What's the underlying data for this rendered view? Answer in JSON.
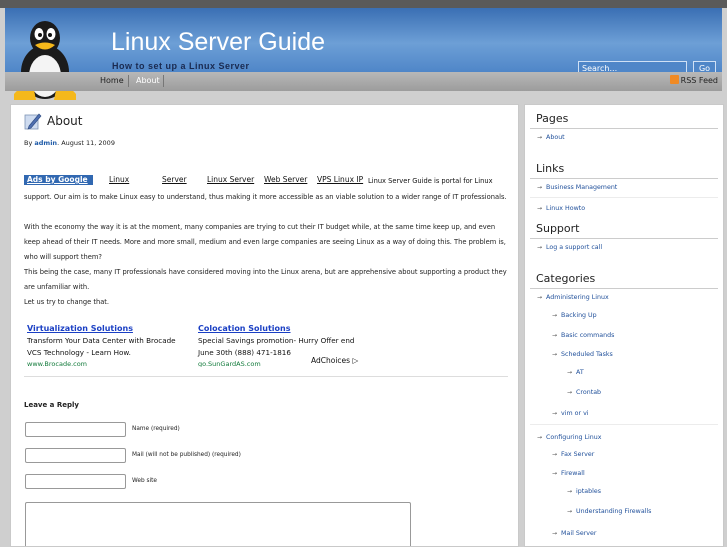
{
  "header": {
    "site_title": "Linux Server Guide",
    "site_description": "How to set up a Linux Server",
    "search_placeholder": "Search...",
    "go_label": "Go"
  },
  "nav": {
    "home": "Home",
    "about": "About",
    "rss": "RSS Feed"
  },
  "post": {
    "title": "About",
    "meta_prefix": "By",
    "author": "admin",
    "date": ". August 11, 2009",
    "ads_label": "Ads by Google",
    "ad_links": [
      "Linux",
      "Server",
      "Linux Server",
      "Web Server",
      "VPS Linux IP"
    ],
    "paragraph_1_line_1": "Linux Server Guide is portal for Linux",
    "paragraph_1_rest": "support. Our aim is to make Linux easy to understand, thus making it more accessible as an viable solution to a wider range of IT professionals.",
    "paragraph_2": "With the economy the way it is at the moment, many companies are trying to cut their IT budget while, at the same time keep up, and even keep ahead of their IT needs. More and more small, medium and even large companies are seeing Linux as a way of doing this. The problem is, who will support them?",
    "paragraph_3": "This being the case, many IT professionals have considered moving into the Linux arena, but are apprehensive about supporting a product they are unfamiliar with.",
    "paragraph_4": "Let us try to change that."
  },
  "ads": [
    {
      "title": "Virtualization Solutions",
      "line1": "Transform Your Data Center with Brocade",
      "line2": "VCS Technology - Learn How.",
      "url": "www.Brocade.com"
    },
    {
      "title": "Colocation Solutions",
      "line1": "Special Savings promotion- Hurry Offer end",
      "line2": "June 30th (888) 471-1816",
      "url": "go.SunGardAS.com"
    }
  ],
  "adchoices": "AdChoices",
  "reply": {
    "title": "Leave a Reply",
    "name_label": "Name (required)",
    "mail_label": "Mail (will not be published) (required)",
    "website_label": "Web site"
  },
  "sidebar": {
    "pages_heading": "Pages",
    "pages": [
      "About"
    ],
    "links_heading": "Links",
    "links": [
      "Business Management",
      "Linux Howto"
    ],
    "support_heading": "Support",
    "support": [
      "Log a support call"
    ],
    "categories_heading": "Categories",
    "categories": [
      "Administering Linux",
      "Backing Up",
      "Basic commands",
      "Scheduled Tasks",
      "AT",
      "Crontab",
      "vim or vi",
      "Configuring Linux",
      "Fax Server",
      "Firewall",
      "iptables",
      "Understanding Firewalls",
      "Mail Server"
    ]
  },
  "colors": {
    "header_blue": "#4f86c8",
    "link_blue": "#1f5ba8",
    "ad_blue": "#3168b1"
  }
}
